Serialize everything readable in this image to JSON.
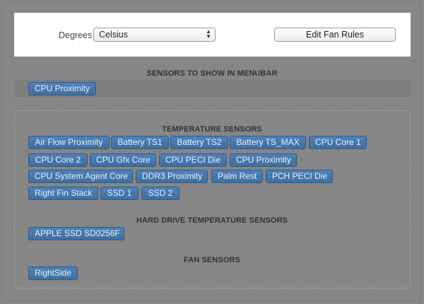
{
  "settings": {
    "degrees_label": "Degrees",
    "degrees_value": "Celsius",
    "edit_fan_rules_label": "Edit Fan Rules"
  },
  "menubar": {
    "heading": "SENSORS TO SHOW IN MENUBAR",
    "sensors": [
      "CPU Proximity"
    ]
  },
  "temperature": {
    "heading": "TEMPERATURE SENSORS",
    "sensors": [
      "Air Flow Proximity",
      "Battery TS1",
      "Battery TS2",
      "Battery TS_MAX",
      "CPU Core 1",
      "CPU Core 2",
      "CPU Gfx Core",
      "CPU PECI Die",
      "CPU Proximity",
      "CPU System Agent Core",
      "DDR3 Proximity",
      "Palm Rest",
      "PCH PECI Die",
      "Right Fin Stack",
      "SSD 1",
      "SSD 2"
    ]
  },
  "hard_drive": {
    "heading": "HARD DRIVE TEMPERATURE SENSORS",
    "sensors": [
      "APPLE SSD SD0256F"
    ]
  },
  "fans": {
    "heading": "FAN SENSORS",
    "sensors": [
      "RightSide"
    ]
  }
}
